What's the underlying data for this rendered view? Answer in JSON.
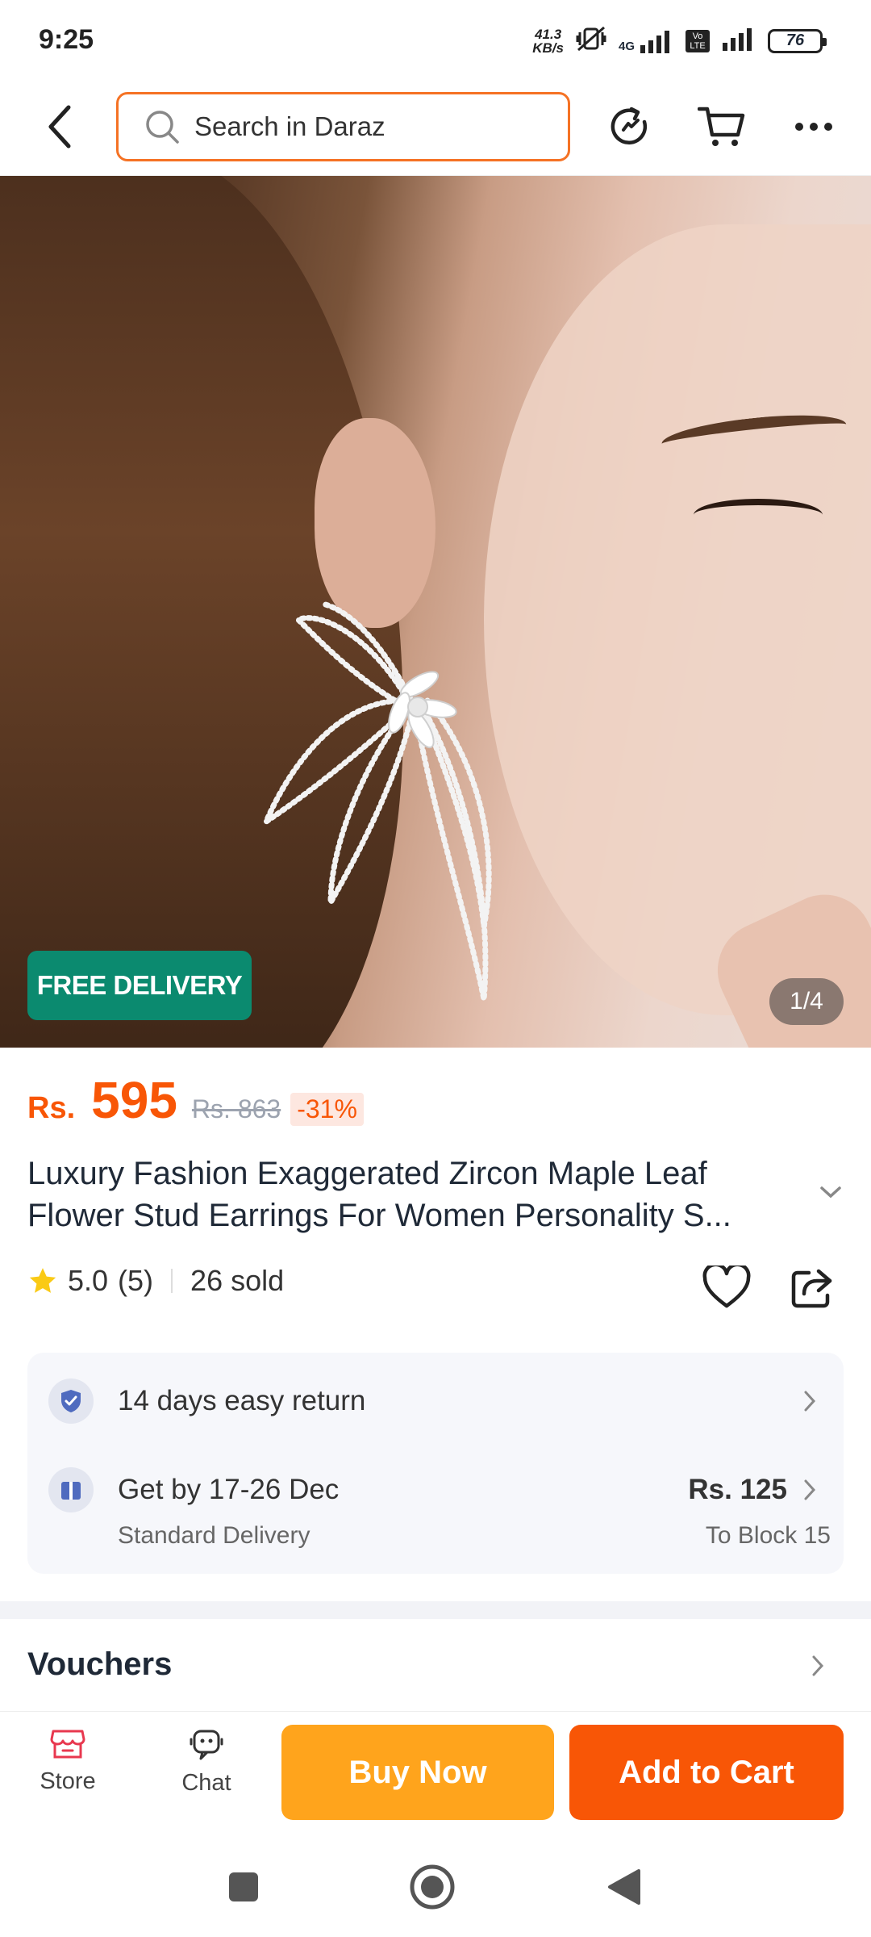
{
  "status_bar": {
    "time": "9:25",
    "net_speed_value": "41.3",
    "net_speed_unit": "KB/s",
    "network": "4G",
    "volte": "Vo LTE",
    "battery": "76"
  },
  "top_nav": {
    "search_placeholder": "Search in Daraz",
    "accent_color": "#f57224"
  },
  "product": {
    "badge": "FREE DELIVERY",
    "image_counter": "1/4",
    "currency": "Rs.",
    "price": "595",
    "old_price": "Rs. 863",
    "discount": "-31%",
    "title_line1": "Luxury Fashion Exaggerated Zircon Maple Leaf",
    "title_line2": "Flower Stud Earrings For Women Personality S...",
    "rating": "5.0",
    "rating_count": "(5)",
    "sold": "26 sold"
  },
  "info": {
    "return_text": "14 days easy return",
    "delivery_text": "Get by 17-26 Dec",
    "delivery_type": "Standard Delivery",
    "delivery_price": "Rs. 125",
    "delivery_dest": "To Block 15"
  },
  "vouchers": {
    "label": "Vouchers"
  },
  "action_bar": {
    "store_label": "Store",
    "chat_label": "Chat",
    "buy_now_label": "Buy Now",
    "add_to_cart_label": "Add to Cart",
    "buy_now_color": "#ffa41c",
    "add_to_cart_color": "#f85606"
  }
}
